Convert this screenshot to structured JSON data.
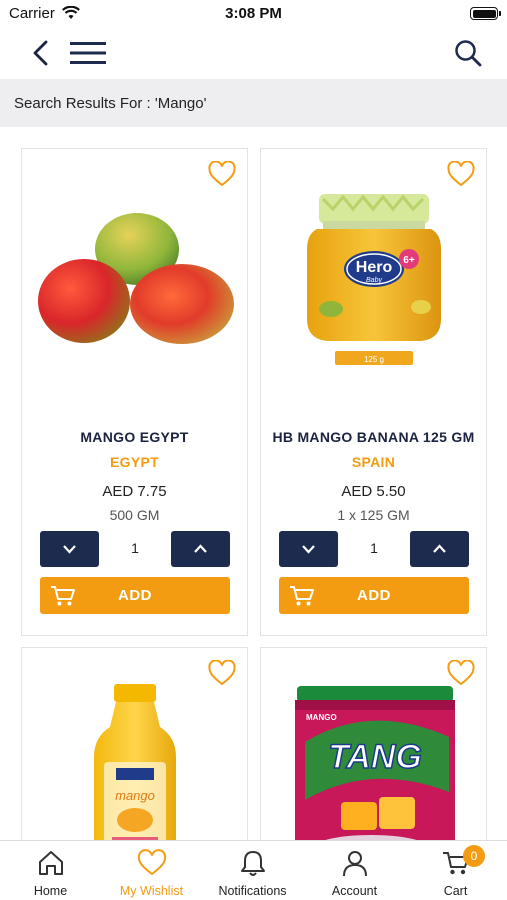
{
  "status_bar": {
    "carrier": "Carrier",
    "time": "3:08 PM"
  },
  "icons": {
    "back": "chevron-left-icon",
    "menu": "hamburger-menu-icon",
    "search": "search-icon",
    "wishlist": "heart-outline-icon",
    "cart": "cart-icon"
  },
  "search": {
    "results_label": "Search Results For : 'Mango'"
  },
  "colors": {
    "accent": "#f39c12",
    "navy": "#1d2b4f",
    "banner_bg": "#eeeef0"
  },
  "products": [
    {
      "name": "MANGO EGYPT",
      "origin": "EGYPT",
      "price": "AED 7.75",
      "size": "500 GM",
      "qty": "1",
      "add_label": "ADD",
      "image": "mangoes"
    },
    {
      "name": "HB MANGO BANANA 125 GM",
      "origin": "SPAIN",
      "price": "AED 5.50",
      "size": "1 x 125 GM",
      "qty": "1",
      "add_label": "ADD",
      "image": "baby-food-jar",
      "jar_brand": "Hero",
      "jar_sub": "Baby",
      "jar_badge": "6+",
      "jar_weight": "125 g"
    },
    {
      "name": "",
      "image": "juice-bottle",
      "label_text": "mango"
    },
    {
      "name": "",
      "image": "tang-canister",
      "brand_top": "MANGO",
      "brand": "TANG"
    }
  ],
  "tabbar": {
    "tabs": [
      {
        "label": "Home",
        "icon": "home-icon"
      },
      {
        "label": "My Wishlist",
        "icon": "heart-icon",
        "active": true
      },
      {
        "label": "Notifications",
        "icon": "bell-icon"
      },
      {
        "label": "Account",
        "icon": "user-icon"
      },
      {
        "label": "Cart",
        "icon": "cart-icon",
        "badge": "0"
      }
    ]
  }
}
